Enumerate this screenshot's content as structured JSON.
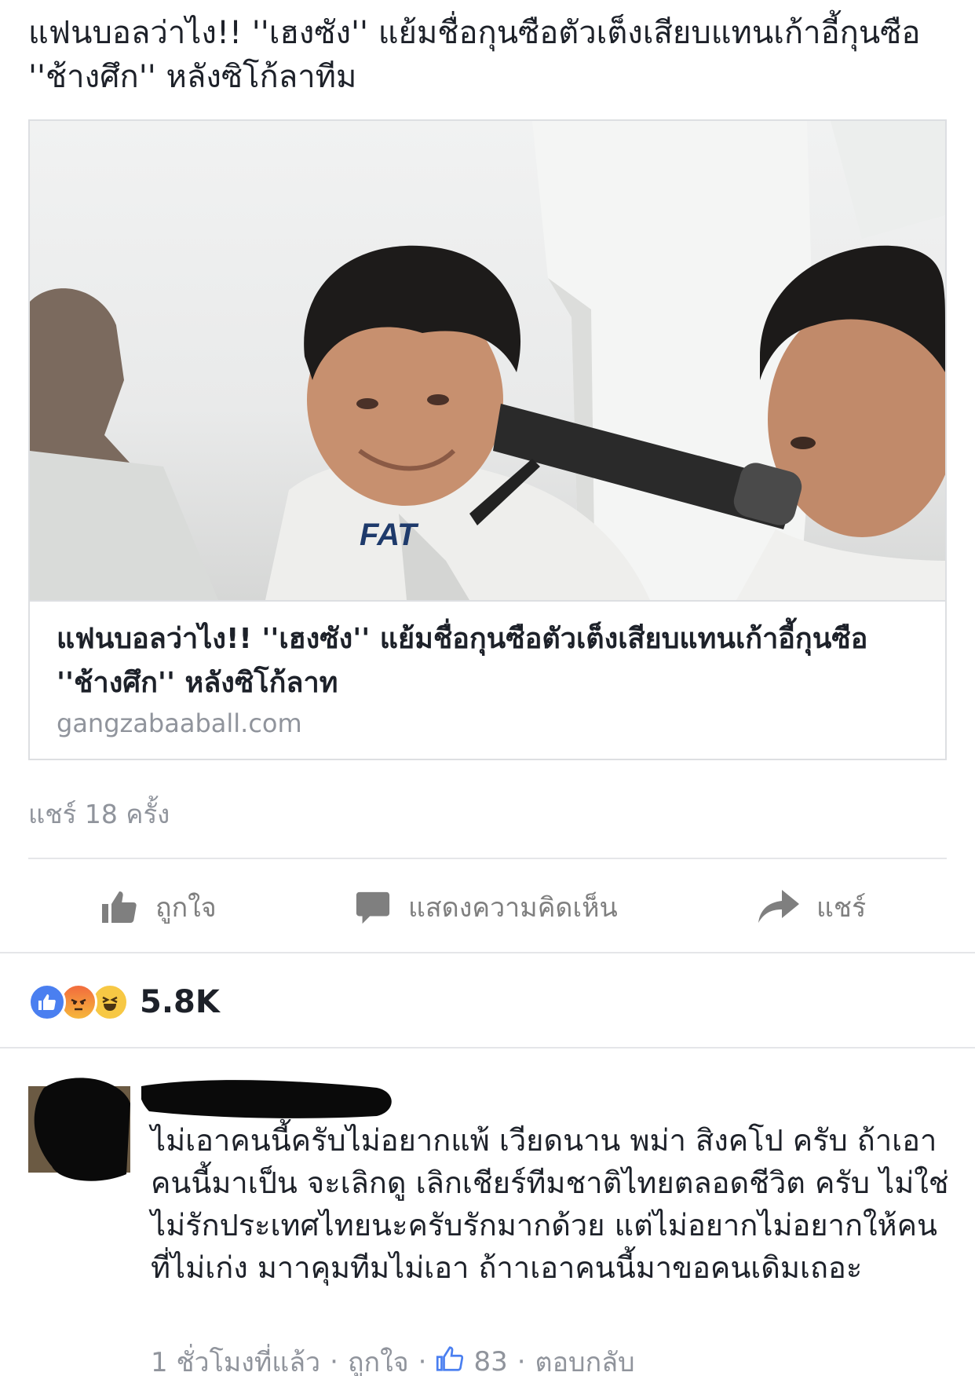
{
  "post": {
    "text": "แฟนบอลว่าไง!! ''เฮงซัง'' แย้มชื่อกุนซือตัวเต็งเสียบแทนเก้าอี้กุนซือ ''ช้างศึก'' หลังซิโก้ลาทีม"
  },
  "link_card": {
    "title": "แฟนบอลว่าไง!! ''เฮงซัง'' แย้มชื่อกุนซือตัวเต็งเสียบแทนเก้าอี้กุนซือ ''ช้างศึก'' หลังซิโก้ลาท",
    "domain": "gangzabaaball.com",
    "shirt_logo": "FAT"
  },
  "share_count": "แชร์ 18 ครั้ง",
  "actions": {
    "like": "ถูกใจ",
    "comment": "แสดงความคิดเห็น",
    "share": "แชร์"
  },
  "reactions": {
    "icons": [
      "like-icon",
      "angry-icon",
      "haha-icon"
    ],
    "count": "5.8K"
  },
  "comment": {
    "text": "ไม่เอาคนนี้ครับไม่อยากแพ้ เวียดนาน พม่า สิงคโป ครับ ถ้าเอาคนนี้มาเป็น จะเลิกดู เลิกเชียร์ทีมชาติไทยตลอดชีวิต ครับ ไม่ใช่ไม่รักประเทศไทยนะครับรักมากด้วย แต่ไม่อยากไม่อยากให้คนที่ไม่เก่ง มาาคุมทีมไม่เอา  ถ้าาเอาคนนี้มาขอคนเดิมเถอะ",
    "time": "1 ชั่วโมงที่แล้ว",
    "like_label": "ถูกใจ",
    "like_count": "83",
    "reply_label": "ตอบกลับ",
    "separator": "·"
  },
  "colors": {
    "text": "#1d2129",
    "secondary": "#90949c",
    "action_gray": "#7f7f7f",
    "like_blue": "#4a7ff0",
    "divider": "#e5e6e9"
  }
}
